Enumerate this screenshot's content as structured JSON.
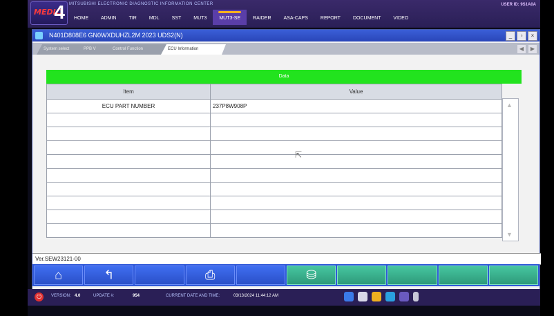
{
  "app": {
    "subtitle": "MITSUBISHI ELECTRONIC DIAGNOSTIC INFORMATION CENTER",
    "logo": "MEDIC",
    "user_id": "USER ID: 9S1A0A"
  },
  "menu": [
    "HOME",
    "ADMIN",
    "TIR",
    "MDL",
    "SST",
    "MUT3",
    "MUT3-SE",
    "RAIDER",
    "ASA-CAPS",
    "REPORT",
    "DOCUMENT",
    "VIDEO"
  ],
  "menu_active": "MUT3-SE",
  "window": {
    "title": "N401D808E6  GN0WXDUHZL2M 2023   UDS2(N)"
  },
  "tabs": [
    {
      "label": "System select"
    },
    {
      "label": "PPB V"
    },
    {
      "label": "Control Function"
    },
    {
      "label": "ECU Information"
    }
  ],
  "table": {
    "header": "Data",
    "columns": [
      "Item",
      "Value"
    ],
    "rows": [
      [
        "ECU PART NUMBER",
        "237P8W908P"
      ],
      [
        "",
        ""
      ],
      [
        "",
        ""
      ],
      [
        "",
        ""
      ],
      [
        "",
        ""
      ],
      [
        "",
        ""
      ],
      [
        "",
        ""
      ],
      [
        "",
        ""
      ],
      [
        "",
        ""
      ],
      [
        "",
        ""
      ]
    ]
  },
  "version": "Ver.SEW23121-00",
  "toolbar_icons": [
    "home-icon",
    "back-icon",
    "",
    "print-icon",
    "",
    "save-icon",
    "",
    "",
    "",
    ""
  ],
  "status": {
    "version_label": "VERSION:",
    "version_value": "4.0",
    "update_label": "UPDATE #:",
    "update_value": "954",
    "datetime_label": "CURRENT DATE AND TIME:",
    "datetime_value": "03/13/2024 11:44:12 AM"
  },
  "colors": {
    "green_header": "#22e31e",
    "toolbar": "#2f58d8",
    "titlebar": "#3b5fd8"
  }
}
